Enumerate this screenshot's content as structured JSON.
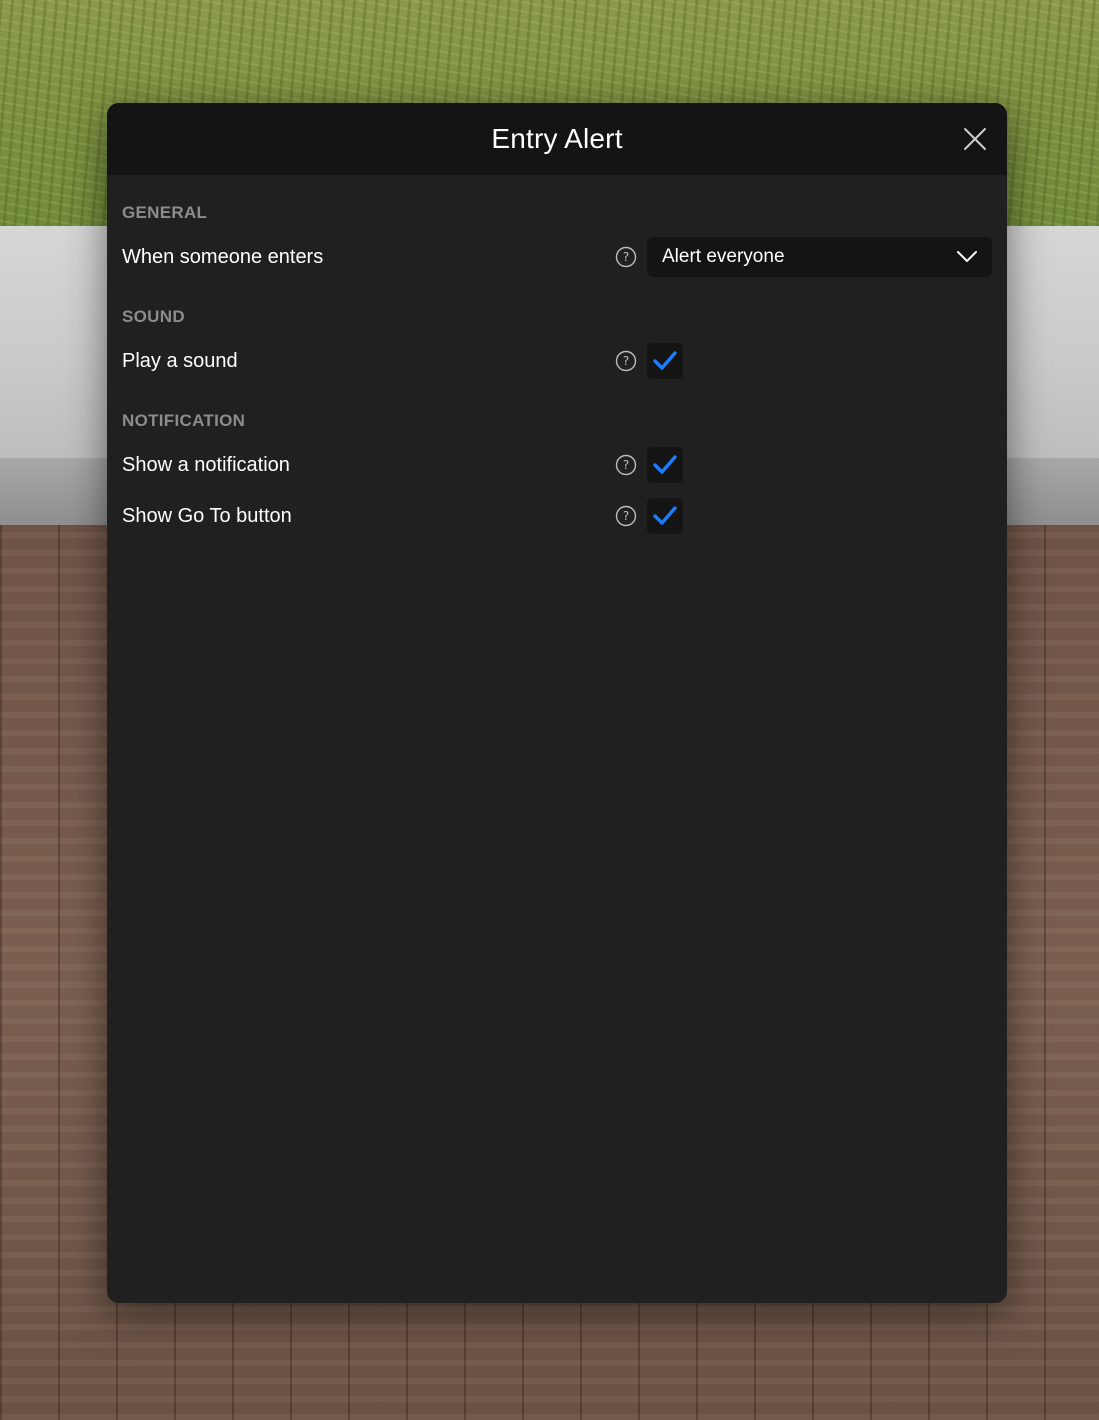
{
  "dialog": {
    "title": "Entry Alert"
  },
  "sections": {
    "general": {
      "heading": "GENERAL",
      "entry_label": "When someone enters",
      "entry_value": "Alert everyone"
    },
    "sound": {
      "heading": "SOUND",
      "play_sound_label": "Play a sound",
      "play_sound_checked": true
    },
    "notification": {
      "heading": "NOTIFICATION",
      "show_notification_label": "Show a notification",
      "show_notification_checked": true,
      "show_goto_label": "Show Go To button",
      "show_goto_checked": true
    }
  },
  "colors": {
    "accent": "#1a7cff",
    "panel": "#202020",
    "header": "#141414",
    "heading_text": "#8c8c8c"
  },
  "icons": {
    "close": "close-icon",
    "help": "help-icon",
    "dropdown": "chevron-down-icon",
    "check": "checkmark-icon"
  }
}
